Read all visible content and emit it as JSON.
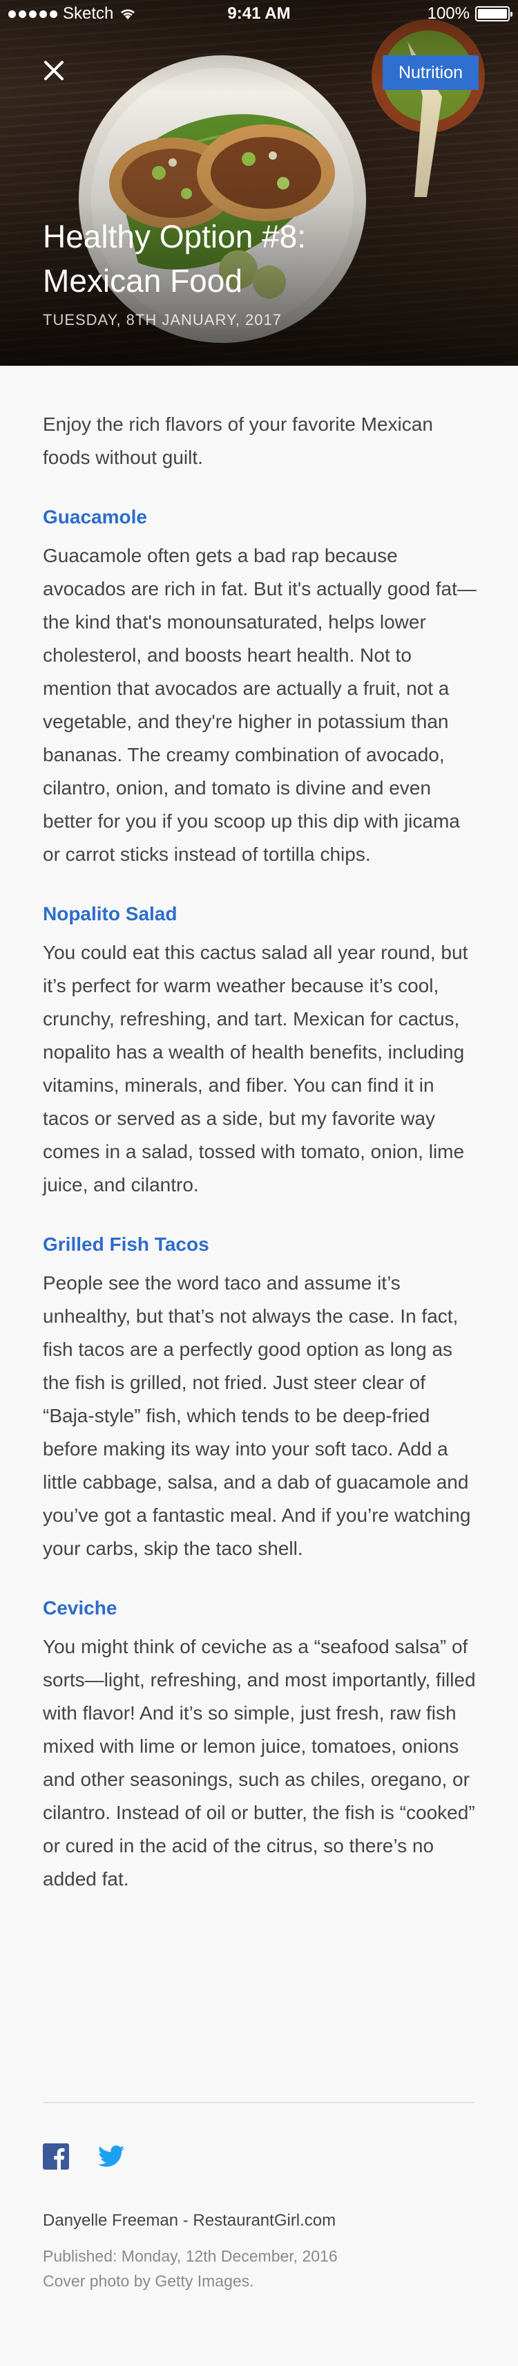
{
  "status_bar": {
    "carrier": "Sketch",
    "time": "9:41 AM",
    "battery": "100%"
  },
  "hero": {
    "nutrition_label": "Nutrition",
    "title": "Healthy Option #8: Mexican Food",
    "date": "TUESDAY, 8TH JANUARY, 2017"
  },
  "article": {
    "intro": "Enjoy the rich flavors of your favorite Mexican foods without guilt.",
    "sections": [
      {
        "title": "Guacamole",
        "body": "Guacamole often gets a bad rap because avocados are rich in fat. But it's actually good fat—the kind that's monounsaturated, helps lower cholesterol, and boosts heart health. Not to mention that avocados are actually a fruit, not a vegetable, and they're higher in potassium than bananas. The creamy combination of avocado, cilantro, onion, and tomato is divine and even better for you if you scoop up this dip with jicama or carrot sticks instead of tortilla chips."
      },
      {
        "title": "Nopalito Salad",
        "body": "You could eat this cactus salad all year round, but it’s perfect for warm weather because it’s cool, crunchy, refreshing, and tart. Mexican for cactus, nopalito has a wealth of health benefits, including vitamins, minerals, and fiber. You can find it in tacos or served as a side, but my favorite way comes in a salad, tossed with tomato, onion, lime juice, and cilantro."
      },
      {
        "title": "Grilled Fish Tacos",
        "body": "People see the word taco and assume it’s unhealthy, but that’s not always the case. In fact, fish tacos are a perfectly good option as long as the fish is grilled, not fried.  Just steer clear of “Baja-style” fish, which tends to be deep-fried before making its way into your soft taco. Add a little cabbage, salsa, and a dab of guacamole and you’ve got a fantastic meal. And if you’re watching your carbs, skip the taco shell."
      },
      {
        "title": "Ceviche",
        "body": "You might think of ceviche as a “seafood salsa” of sorts—light, refreshing, and most importantly, filled with flavor! And it’s so simple, just fresh, raw fish mixed with lime or lemon juice, tomatoes, onions and other seasonings, such as chiles, oregano, or cilantro. Instead of oil or butter, the fish is “cooked” or cured in the acid of the citrus, so there’s no added fat."
      }
    ]
  },
  "footer": {
    "author": "Danyelle Freeman - RestaurantGirl.com",
    "published": "Published: Monday, 12th December, 2016",
    "credit": "Cover photo by Getty Images."
  },
  "colors": {
    "accent": "#2d6ccb",
    "nutrition_button": "#2f6fcf",
    "facebook": "#3b5998",
    "twitter": "#1da1f2"
  }
}
